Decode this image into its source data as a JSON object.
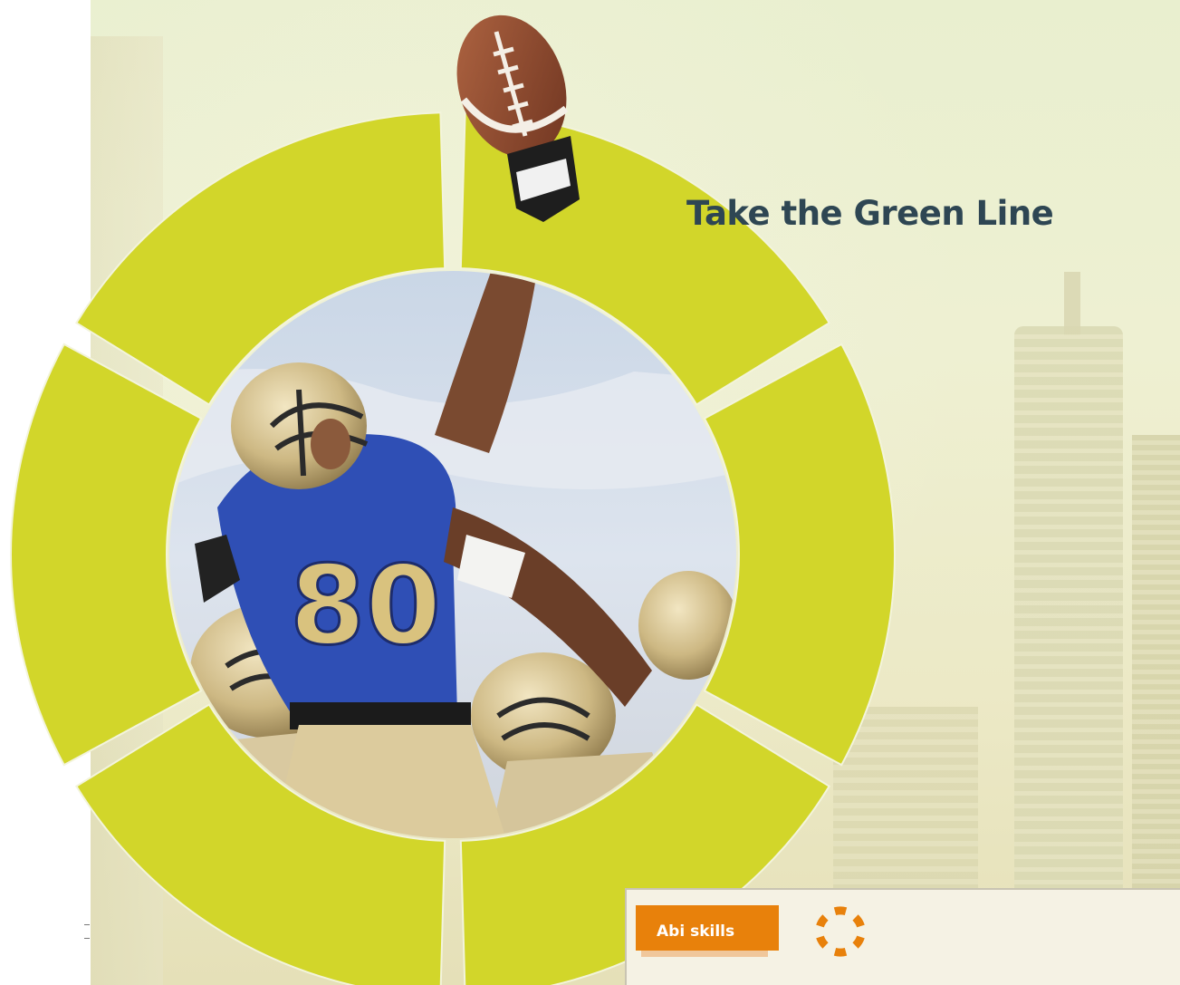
{
  "title": "Take the Green Line",
  "abi_panel": {
    "tab_label": "Abi skills",
    "icon": "abi-skills-ring-icon",
    "accent_color": "#e8810b"
  },
  "wheel": {
    "segments": 6,
    "segment_color": "#d2d62a",
    "photo": "american-football-player-catching-ball-photo"
  },
  "colors": {
    "title": "#2e4653",
    "background": "#eef0d2",
    "panel": "#f5f2e4"
  }
}
